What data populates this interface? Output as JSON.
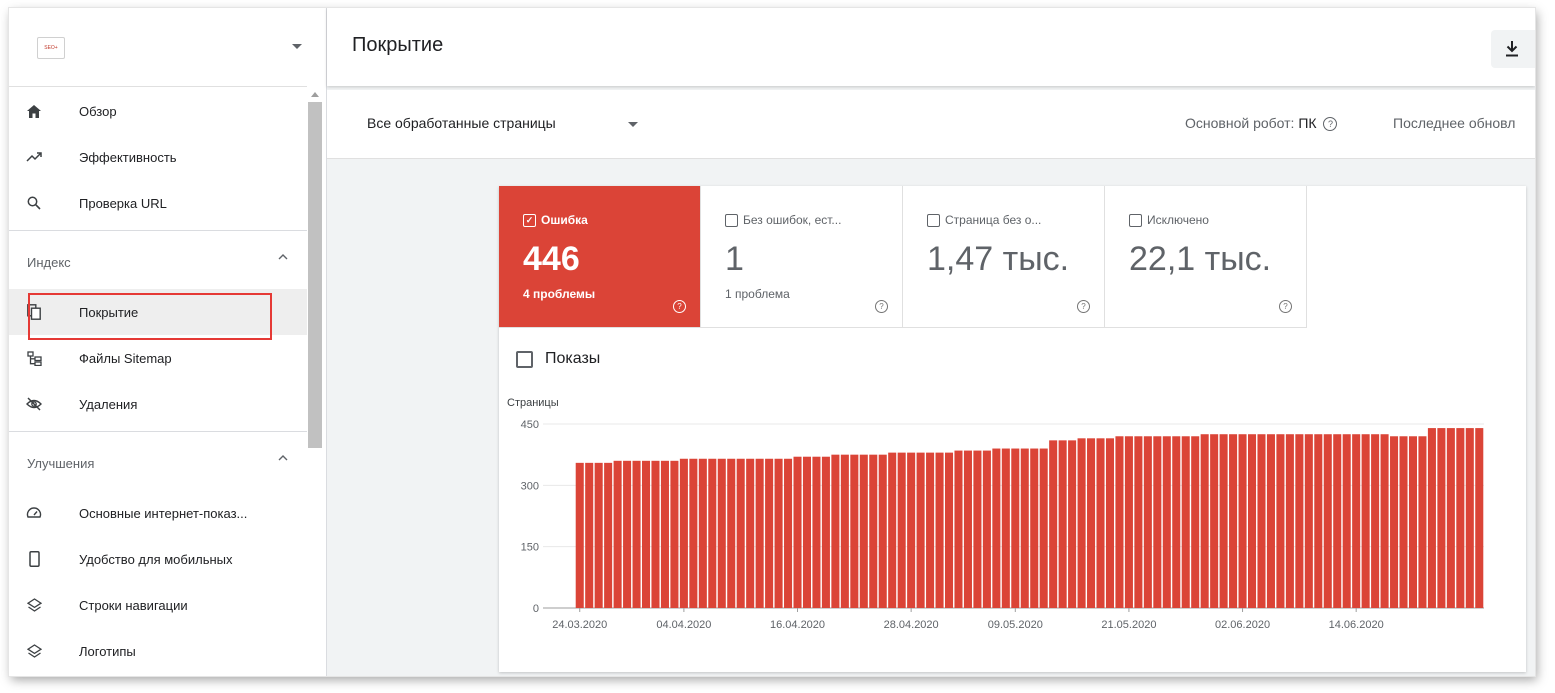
{
  "sidebar": {
    "property_logo_text": "SEO+",
    "items_top": [
      {
        "label": "Обзор",
        "icon": "home-icon"
      },
      {
        "label": "Эффективность",
        "icon": "trending-up-icon"
      },
      {
        "label": "Проверка URL",
        "icon": "search-icon"
      }
    ],
    "sections": [
      {
        "title": "Индекс",
        "items": [
          {
            "label": "Покрытие",
            "icon": "coverage-icon",
            "active": true
          },
          {
            "label": "Файлы Sitemap",
            "icon": "sitemap-icon"
          },
          {
            "label": "Удаления",
            "icon": "eye-off-icon"
          }
        ]
      },
      {
        "title": "Улучшения",
        "items": [
          {
            "label": "Основные интернет-показ...",
            "icon": "speedometer-icon"
          },
          {
            "label": "Удобство для мобильных",
            "icon": "smartphone-icon"
          },
          {
            "label": "Строки навигации",
            "icon": "layers-icon"
          },
          {
            "label": "Логотипы",
            "icon": "layers-icon"
          }
        ]
      }
    ]
  },
  "header": {
    "title": "Покрытие"
  },
  "filter": {
    "selected": "Все обработанные страницы",
    "crawler_label": "Основной робот:",
    "crawler_value": "ПК",
    "updated_label": "Последнее обновл"
  },
  "tiles": [
    {
      "label": "Ошибка",
      "value": "446",
      "sub": "4 проблемы",
      "checked": true
    },
    {
      "label": "Без ошибок, ест...",
      "value": "1",
      "sub": "1 проблема",
      "checked": false
    },
    {
      "label": "Страница без о...",
      "value": "1,47 тыс.",
      "sub": "",
      "checked": false
    },
    {
      "label": "Исключено",
      "value": "22,1 тыс.",
      "sub": "",
      "checked": false
    }
  ],
  "impressions": {
    "label": "Показы",
    "checked": false
  },
  "chart_data": {
    "type": "bar",
    "ylabel": "Страницы",
    "ylim": [
      0,
      450
    ],
    "yticks": [
      0,
      150,
      300,
      450
    ],
    "xtick_labels": [
      "24.03.2020",
      "04.04.2020",
      "16.04.2020",
      "28.04.2020",
      "09.05.2020",
      "21.05.2020",
      "02.06.2020",
      "14.06.2020"
    ],
    "xtick_indices": [
      0,
      11,
      23,
      35,
      46,
      58,
      70,
      82
    ],
    "color": "#db4437",
    "start_date": "24.03.2020",
    "values": [
      355,
      355,
      355,
      355,
      360,
      360,
      360,
      360,
      360,
      360,
      360,
      365,
      365,
      365,
      365,
      365,
      365,
      365,
      365,
      365,
      365,
      365,
      365,
      370,
      370,
      370,
      370,
      375,
      375,
      375,
      375,
      375,
      375,
      380,
      380,
      380,
      380,
      380,
      380,
      380,
      385,
      385,
      385,
      385,
      390,
      390,
      390,
      390,
      390,
      390,
      410,
      410,
      410,
      415,
      415,
      415,
      415,
      420,
      420,
      420,
      420,
      420,
      420,
      420,
      420,
      420,
      425,
      425,
      425,
      425,
      425,
      425,
      425,
      425,
      425,
      425,
      425,
      425,
      425,
      425,
      425,
      425,
      425,
      425,
      425,
      425,
      420,
      420,
      420,
      420,
      440,
      440,
      440,
      440,
      440,
      440
    ]
  }
}
